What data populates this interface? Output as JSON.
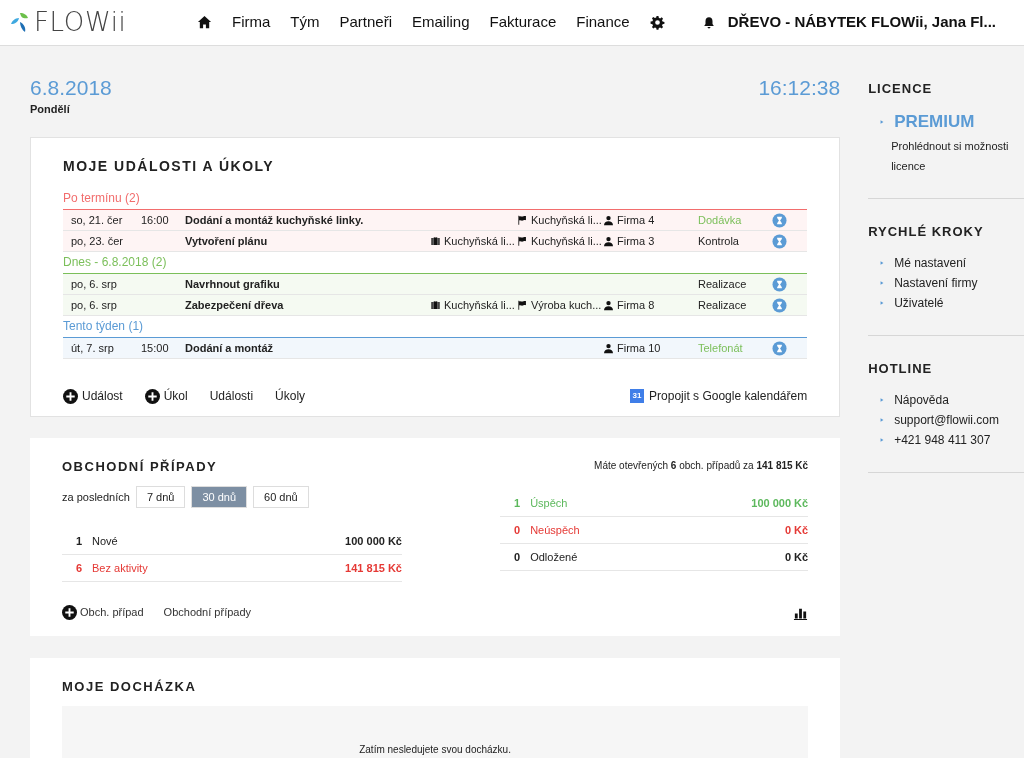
{
  "logo": {
    "text": "FLOWii"
  },
  "nav": {
    "items": [
      {
        "label": "Firma"
      },
      {
        "label": "Tým"
      },
      {
        "label": "Partneři"
      },
      {
        "label": "Emailing"
      },
      {
        "label": "Fakturace"
      },
      {
        "label": "Finance"
      }
    ],
    "user": "DŘEVO - NÁBYTEK FLOWii, Jana Fl..."
  },
  "date": {
    "date": "6.8.2018",
    "weekday": "Pondělí",
    "time": "16:12:38"
  },
  "events": {
    "title": "MOJE UDÁLOSTI A ÚKOLY",
    "groups": [
      {
        "label": "Po termínu (2)",
        "color": "#f26d6d",
        "rows": [
          {
            "date": "so, 21. čer",
            "time": "16:00",
            "title": "Dodání a montáž kuchyňské linky.",
            "order": "Kuchyňská li...",
            "company": "Firma 4",
            "type": "Dodávka",
            "color": "#7bbf5a"
          },
          {
            "date": "po, 23. čer",
            "title": "Vytvoření plánu",
            "project": "Kuchyňská li...",
            "order": "Kuchyňská li...",
            "company": "Firma 3",
            "type": "Kontrola",
            "color": "#222222"
          }
        ]
      },
      {
        "label": "Dnes - 6.8.2018 (2)",
        "color": "#7bbf5a",
        "rows": [
          {
            "date": "po, 6. srp",
            "title": "Navrhnout grafiku",
            "type": "Realizace",
            "color": "#222222"
          },
          {
            "date": "po, 6. srp",
            "title": "Zabezpečení dřeva",
            "project": "Kuchyňská li...",
            "order": "Výroba kuch...",
            "company": "Firma 8",
            "type": "Realizace",
            "color": "#222222"
          }
        ]
      },
      {
        "label": "Tento týden (1)",
        "color": "#5b9bd5",
        "rows": [
          {
            "date": "út, 7. srp",
            "time": "15:00",
            "title": "Dodání a montáž",
            "company": "Firma 10",
            "type": "Telefonát",
            "color": "#7bbf5a"
          }
        ]
      }
    ],
    "actions": [
      {
        "label": "Událost",
        "kind": "add"
      },
      {
        "label": "Úkol",
        "kind": "add"
      },
      {
        "label": "Události",
        "kind": "link"
      },
      {
        "label": "Úkoly",
        "kind": "link"
      }
    ],
    "google": "Propojit s Google kalendářem",
    "google_icon": "31"
  },
  "deals": {
    "title": "OBCHODNÍ PŘÍPADY",
    "summary": "Máte otevřených **6** obch. případů za **141 815 Kč**",
    "period_label": "za posledních",
    "periods": [
      {
        "label": "7 dnů",
        "selected": false
      },
      {
        "label": "30 dnů",
        "selected": true
      },
      {
        "label": "60 dnů",
        "selected": false
      }
    ],
    "left": [
      {
        "count": "1",
        "label": "Nové",
        "amount": "100 000 Kč",
        "color": "#222222"
      },
      {
        "count": "6",
        "label": "Bez aktivity",
        "amount": "141 815 Kč",
        "color": "#e53935"
      }
    ],
    "right": [
      {
        "count": "1",
        "label": "Úspěch",
        "amount": "100 000 Kč",
        "color": "#5cb85c"
      },
      {
        "count": "0",
        "label": "Neúspěch",
        "amount": "0 Kč",
        "color": "#e53935"
      },
      {
        "count": "0",
        "label": "Odložené",
        "amount": "0 Kč",
        "color": "#222222"
      }
    ],
    "actions": [
      {
        "label": "Obch. případ",
        "kind": "add"
      },
      {
        "label": "Obchodní případy",
        "kind": "link"
      }
    ]
  },
  "attendance": {
    "title": "MOJE DOCHÁZKA",
    "message": "Zatím nesledujete svou docházku."
  },
  "sidebar": [
    {
      "title": "LICENCE",
      "items": [
        {
          "text": "PREMIUM",
          "kind": "highlight"
        },
        {
          "text": "Prohlédnout si možnosti licence",
          "kind": "note"
        }
      ]
    },
    {
      "title": "RYCHLÉ KROKY",
      "items": [
        {
          "text": "Mé nastavení",
          "kind": "link"
        },
        {
          "text": "Nastavení firmy",
          "kind": "link"
        },
        {
          "text": "Uživatelé",
          "kind": "link"
        }
      ]
    },
    {
      "title": "HOTLINE",
      "items": [
        {
          "text": "Nápověda",
          "kind": "link"
        },
        {
          "text": "support@flowii.com",
          "kind": "link"
        },
        {
          "text": "+421 948 411 307",
          "kind": "link"
        }
      ]
    }
  ]
}
